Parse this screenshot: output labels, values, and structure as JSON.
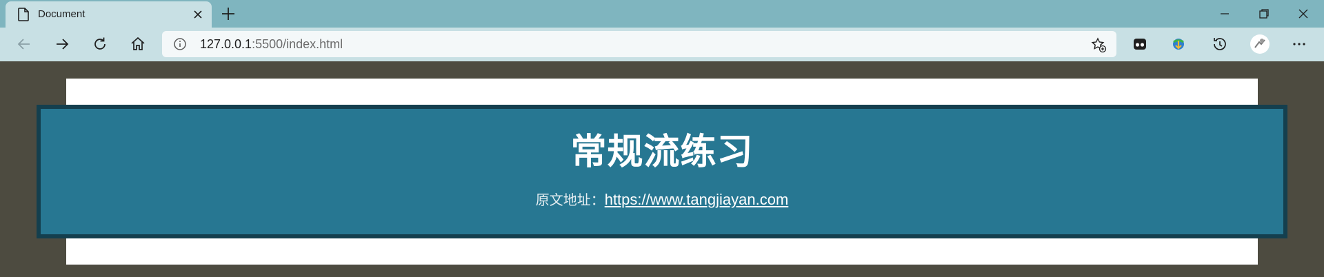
{
  "browser": {
    "tab_title": "Document",
    "icons": {
      "tab": "document-icon",
      "close": "close-icon",
      "new_tab": "plus-icon",
      "back": "arrow-left-icon",
      "forward": "arrow-right-icon",
      "refresh": "refresh-icon",
      "home": "home-icon",
      "info": "info-icon",
      "favorite": "star-add-icon",
      "extension1": "extension-icon",
      "extension2": "downloader-icon",
      "history": "history-icon",
      "profile": "avatar",
      "menu": "more-icon"
    },
    "address": {
      "host": "127.0.0.1",
      "rest": ":5500/index.html"
    }
  },
  "page": {
    "heading": "常规流练习",
    "source_label": "原文地址：",
    "source_link": "https://www.tangjiayan.com"
  },
  "colors": {
    "page_bg": "#4d4b40",
    "banner_bg": "#277792",
    "banner_border": "#143f4e",
    "chrome_tab_strip": "#7fb5bf",
    "chrome_toolbar": "#c8e0e4"
  }
}
